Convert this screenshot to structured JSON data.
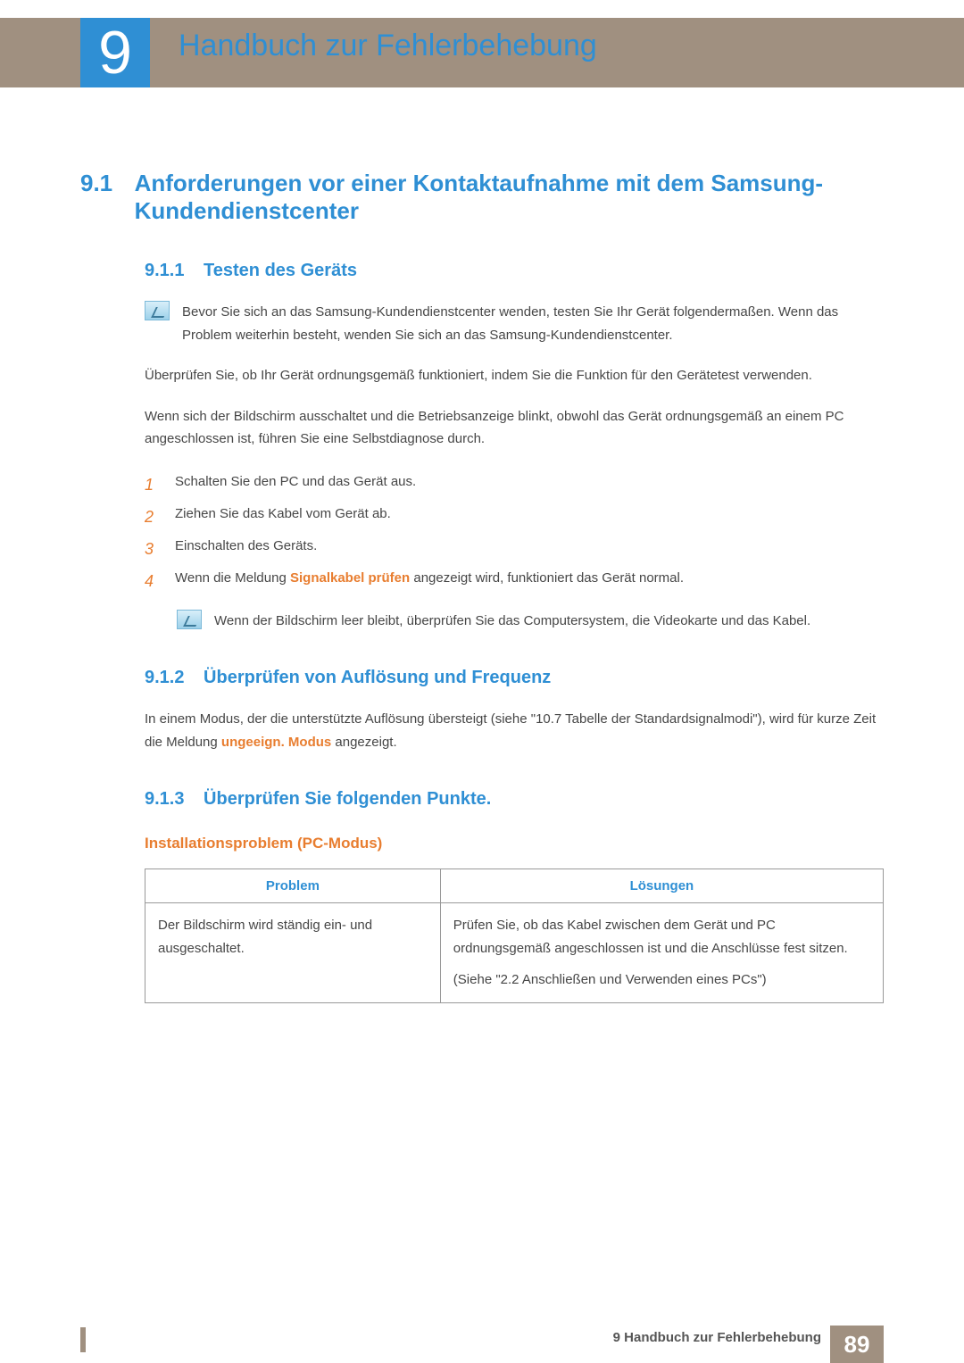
{
  "chapter": {
    "number": "9",
    "title": "Handbuch zur Fehlerbehebung"
  },
  "section": {
    "number": "9.1",
    "title": "Anforderungen vor einer Kontaktaufnahme mit dem Samsung-Kundendienstcenter"
  },
  "sub1": {
    "number": "9.1.1",
    "title": "Testen des Geräts",
    "note": "Bevor Sie sich an das Samsung-Kundendienstcenter wenden, testen Sie Ihr Gerät folgendermaßen. Wenn das Problem weiterhin besteht, wenden Sie sich an das Samsung-Kundendienstcenter.",
    "p1": "Überprüfen Sie, ob Ihr Gerät ordnungsgemäß funktioniert, indem Sie die Funktion für den Gerätetest verwenden.",
    "p2": "Wenn sich der Bildschirm ausschaltet und die Betriebsanzeige blinkt, obwohl das Gerät ordnungsgemäß an einem PC angeschlossen ist, führen Sie eine Selbstdiagnose durch.",
    "steps": [
      "Schalten Sie den PC und das Gerät aus.",
      "Ziehen Sie das Kabel vom Gerät ab.",
      "Einschalten des Geräts."
    ],
    "step4_pre": "Wenn die Meldung ",
    "step4_bold": "Signalkabel prüfen",
    "step4_post": " angezeigt wird, funktioniert das Gerät normal.",
    "note2": "Wenn der Bildschirm leer bleibt, überprüfen Sie das Computersystem, die Videokarte und das Kabel."
  },
  "sub2": {
    "number": "9.1.2",
    "title": "Überprüfen von Auflösung und Frequenz",
    "p_pre": "In einem Modus, der die unterstützte Auflösung übersteigt (siehe \"10.7 Tabelle der Standardsignalmodi\"), wird für kurze Zeit die Meldung ",
    "p_bold": "ungeeign. Modus",
    "p_post": " angezeigt."
  },
  "sub3": {
    "number": "9.1.3",
    "title": "Überprüfen Sie folgenden Punkte.",
    "group": "Installationsproblem (PC-Modus)",
    "th1": "Problem",
    "th2": "Lösungen",
    "row1_problem": "Der Bildschirm wird ständig ein- und ausgeschaltet.",
    "row1_sol1": "Prüfen Sie, ob das Kabel zwischen dem Gerät und PC ordnungsgemäß angeschlossen ist und die Anschlüsse fest sitzen.",
    "row1_sol2": "(Siehe \"2.2 Anschließen und Verwenden eines PCs\")"
  },
  "footer": {
    "text": "9 Handbuch zur Fehlerbehebung",
    "page": "89"
  }
}
